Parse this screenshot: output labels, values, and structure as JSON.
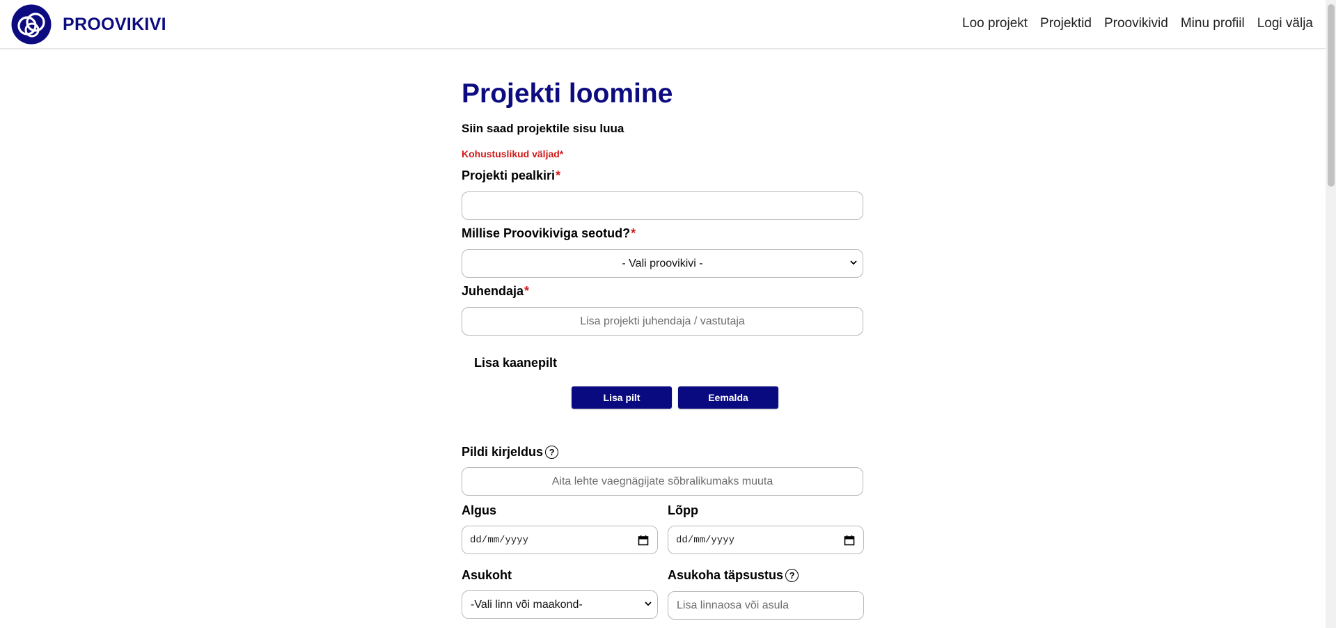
{
  "header": {
    "brand": "PROOVIKIVI",
    "nav": [
      "Loo projekt",
      "Projektid",
      "Proovikivid",
      "Minu profiil",
      "Logi välja"
    ]
  },
  "form": {
    "title": "Projekti loomine",
    "subtitle": "Siin saad projektile sisu luua",
    "required_note": "Kohustuslikud väljad*",
    "project_title": {
      "label": "Projekti pealkiri",
      "star": "*",
      "value": "",
      "placeholder": ""
    },
    "proovikivi": {
      "label": "Millise Proovikiviga seotud?",
      "star": "*",
      "selected": "- Vali proovikivi -"
    },
    "supervisor": {
      "label": "Juhendaja",
      "star": "*",
      "placeholder": "Lisa projekti juhendaja / vastutaja"
    },
    "cover": {
      "label": "Lisa kaanepilt",
      "add_button": "Lisa pilt",
      "remove_button": "Eemalda"
    },
    "image_description": {
      "label": "Pildi kirjeldus",
      "help": "?",
      "placeholder": "Aita lehte vaegnägijate sõbralikumaks muuta"
    },
    "start": {
      "label": "Algus",
      "placeholder": "dd/mm/yyyy"
    },
    "end": {
      "label": "Lõpp",
      "placeholder": "dd/mm/yyyy"
    },
    "location": {
      "label": "Asukoht",
      "selected": "-Vali linn või maakond-"
    },
    "location_detail": {
      "label": "Asukoha täpsustus",
      "help": "?",
      "placeholder": "Lisa linnaosa või asula"
    }
  },
  "colors": {
    "brand": "#0c0c80",
    "required": "#d11a1a",
    "button": "#0a0a80"
  }
}
